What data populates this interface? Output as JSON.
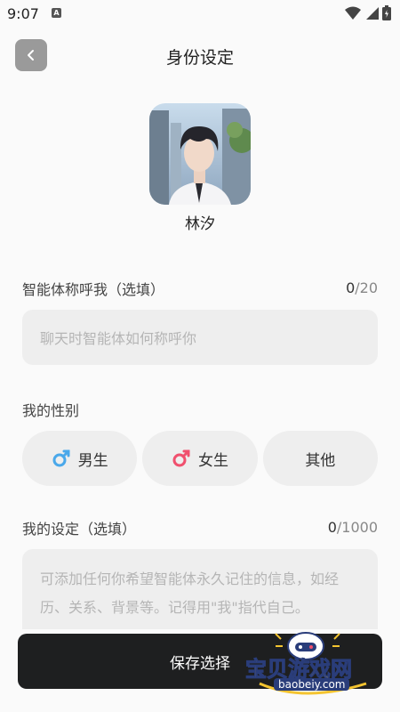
{
  "status_bar": {
    "time": "9:07",
    "notification_badge": "A"
  },
  "header": {
    "title": "身份设定",
    "back_icon": "chevron-left-icon"
  },
  "avatar": {
    "name": "林汐"
  },
  "nickname": {
    "label": "智能体称呼我（选填）",
    "count": "0",
    "max": "/20",
    "placeholder": "聊天时智能体如何称呼你"
  },
  "gender": {
    "label": "我的性别",
    "options": [
      {
        "label": "男生",
        "icon": "male-symbol-icon",
        "color": "#4aa8ea"
      },
      {
        "label": "女生",
        "icon": "female-symbol-icon",
        "color": "#f0506e"
      },
      {
        "label": "其他"
      }
    ]
  },
  "settings": {
    "label": "我的设定（选填）",
    "count": "0",
    "max": "/1000",
    "placeholder": "可添加任何你希望智能体永久记住的信息，如经历、关系、背景等。记得用\"我\"指代自己。"
  },
  "footer": {
    "save_label": "保存选择"
  },
  "watermark": {
    "title": "宝贝游戏网",
    "url": "baobeiy.com"
  }
}
